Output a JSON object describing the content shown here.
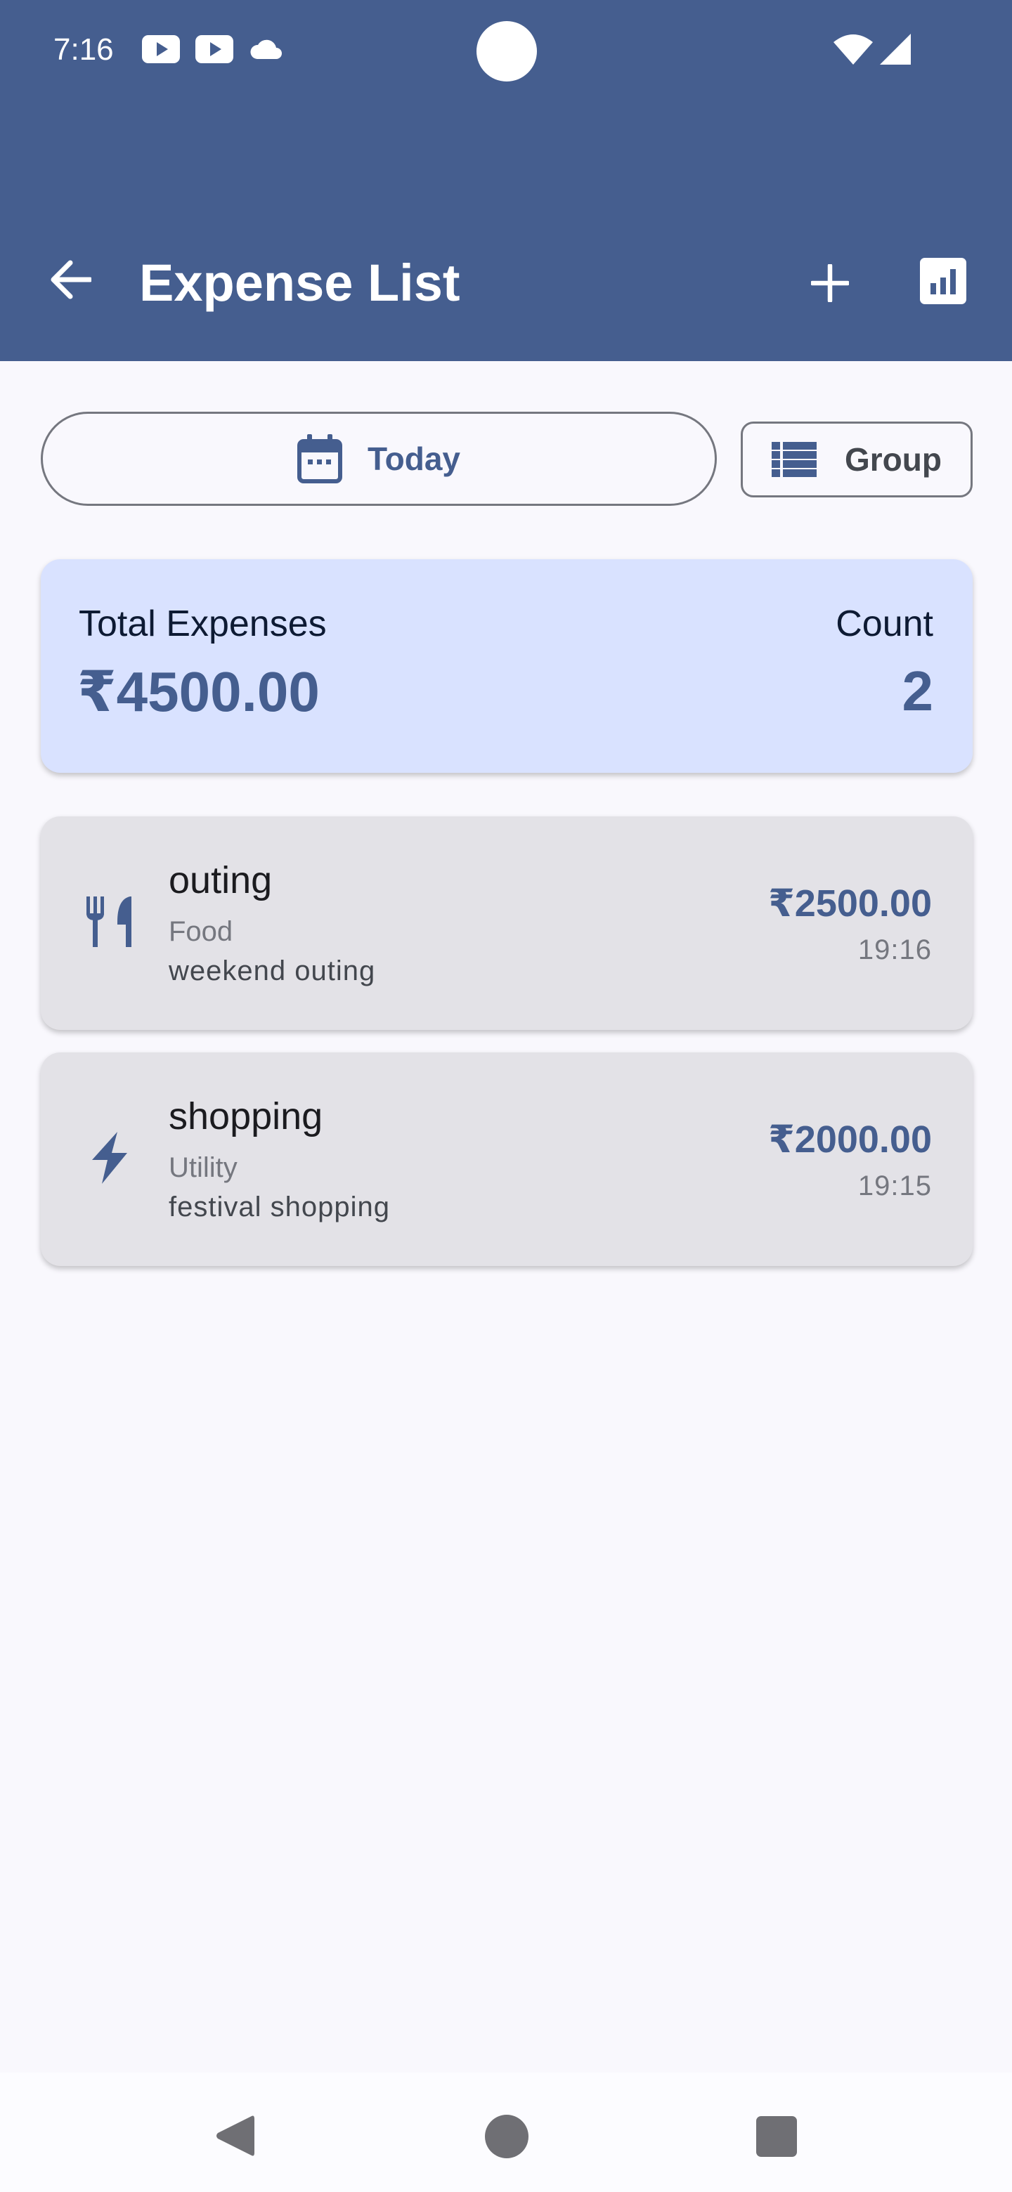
{
  "status_bar": {
    "time": "7:16",
    "icons_left": [
      "youtube-icon",
      "youtube-icon",
      "cloud-icon"
    ],
    "icons_right": [
      "wifi-icon",
      "signal-icon"
    ]
  },
  "app_bar": {
    "title": "Expense List",
    "background": "#455e8f",
    "actions": [
      "back-arrow-icon",
      "add-icon",
      "bar-chart-icon"
    ]
  },
  "filters": {
    "date_label": "Today",
    "group_label": "Group"
  },
  "summary": {
    "total_label": "Total Expenses",
    "total_value": "₹4500.00",
    "count_label": "Count",
    "count_value": "2",
    "background": "#d9e2ff"
  },
  "expenses": [
    {
      "title": "outing",
      "category": "Food",
      "description": "weekend outing",
      "amount": "₹2500.00",
      "time": "19:16",
      "icon": "restaurant-icon"
    },
    {
      "title": "shopping",
      "category": "Utility",
      "description": "festival shopping",
      "amount": "₹2000.00",
      "time": "19:15",
      "icon": "bolt-icon"
    }
  ],
  "accent_color": "#455e8f"
}
